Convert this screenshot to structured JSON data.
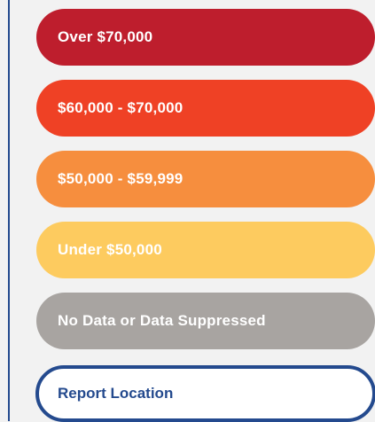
{
  "legend": {
    "items": [
      {
        "label": "Over $70,000",
        "color": "#be1e2d"
      },
      {
        "label": "$60,000 - $70,000",
        "color": "#ef4125"
      },
      {
        "label": "$50,000 - $59,999",
        "color": "#f68e3e"
      },
      {
        "label": "Under $50,000",
        "color": "#fdcb5f"
      },
      {
        "label": "No Data or Data Suppressed",
        "color": "#a8a4a1"
      }
    ]
  },
  "report_button": {
    "label": "Report Location",
    "color": "#244a8e"
  }
}
